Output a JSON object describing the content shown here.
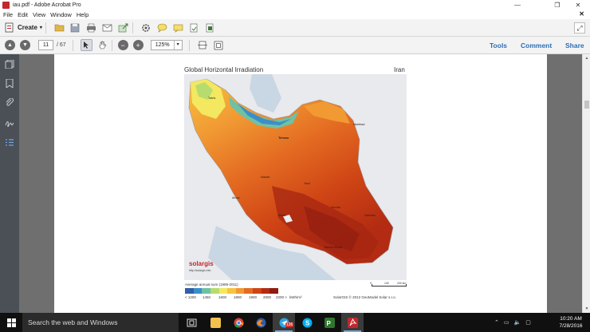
{
  "window": {
    "title": "iau.pdf - Adobe Acrobat Pro",
    "controls": {
      "minimize": "—",
      "maximize": "❐",
      "close": "✕"
    }
  },
  "menu": {
    "items": [
      "File",
      "Edit",
      "View",
      "Window",
      "Help"
    ],
    "close_doc": "✕"
  },
  "toolbar": {
    "create_label": "Create",
    "create_caret": "▾",
    "tool_icons": [
      "open-folder-icon",
      "save-icon",
      "print-icon",
      "email-icon",
      "share-icon",
      "gear-icon",
      "comment-icon",
      "highlight-icon",
      "stamp-icon",
      "attach-icon"
    ],
    "expand_icon": "⤢"
  },
  "nav": {
    "page_current": "11",
    "page_separator": "/ 67",
    "zoom": "125%",
    "zoom_caret": "▾"
  },
  "panels": {
    "tools": "Tools",
    "comment": "Comment",
    "share": "Share"
  },
  "document": {
    "map_title": "Global Horizontal Irradiation",
    "map_region": "Iran",
    "legend_caption": "Average annual sum (1999-2011)",
    "legend_colors": [
      "#2f5fa8",
      "#3b8fc9",
      "#6fc1a5",
      "#b6dc6f",
      "#f3e860",
      "#f6c442",
      "#f19a33",
      "#e46b22",
      "#cf4515",
      "#b32b12",
      "#8e1c10"
    ],
    "legend_labels": [
      "< 1200",
      "1450",
      "1600",
      "1800",
      "1900",
      "2000",
      "2200 >",
      "kWh/m²"
    ],
    "credit": "SolarGIS © 2012 GeoModel Solar s.r.o.",
    "scale_labels": [
      "0",
      "100",
      "200 km"
    ],
    "brand": "solargis",
    "brand_url": "http://solargis.info",
    "cities": [
      "Tehran",
      "Mashhad",
      "Tabriz",
      "Isfahan",
      "Shiraz",
      "Kerman",
      "Ahvaz",
      "Zahedan",
      "Yazd",
      "Bandar Abbas"
    ]
  },
  "taskbar": {
    "search_placeholder": "Search the web and Windows",
    "apps": [
      "task-view-icon",
      "file-explorer-icon",
      "chrome-icon",
      "firefox-icon",
      "telegram-icon",
      "skype-icon",
      "project-icon",
      "acrobat-icon"
    ],
    "telegram_badge": "136",
    "time": "10:20 AM",
    "date": "7/28/2016"
  },
  "colors": {
    "accent_link": "#2d6fb5",
    "acrobat_red": "#c1272d",
    "doc_bg": "#6f6f6f"
  }
}
